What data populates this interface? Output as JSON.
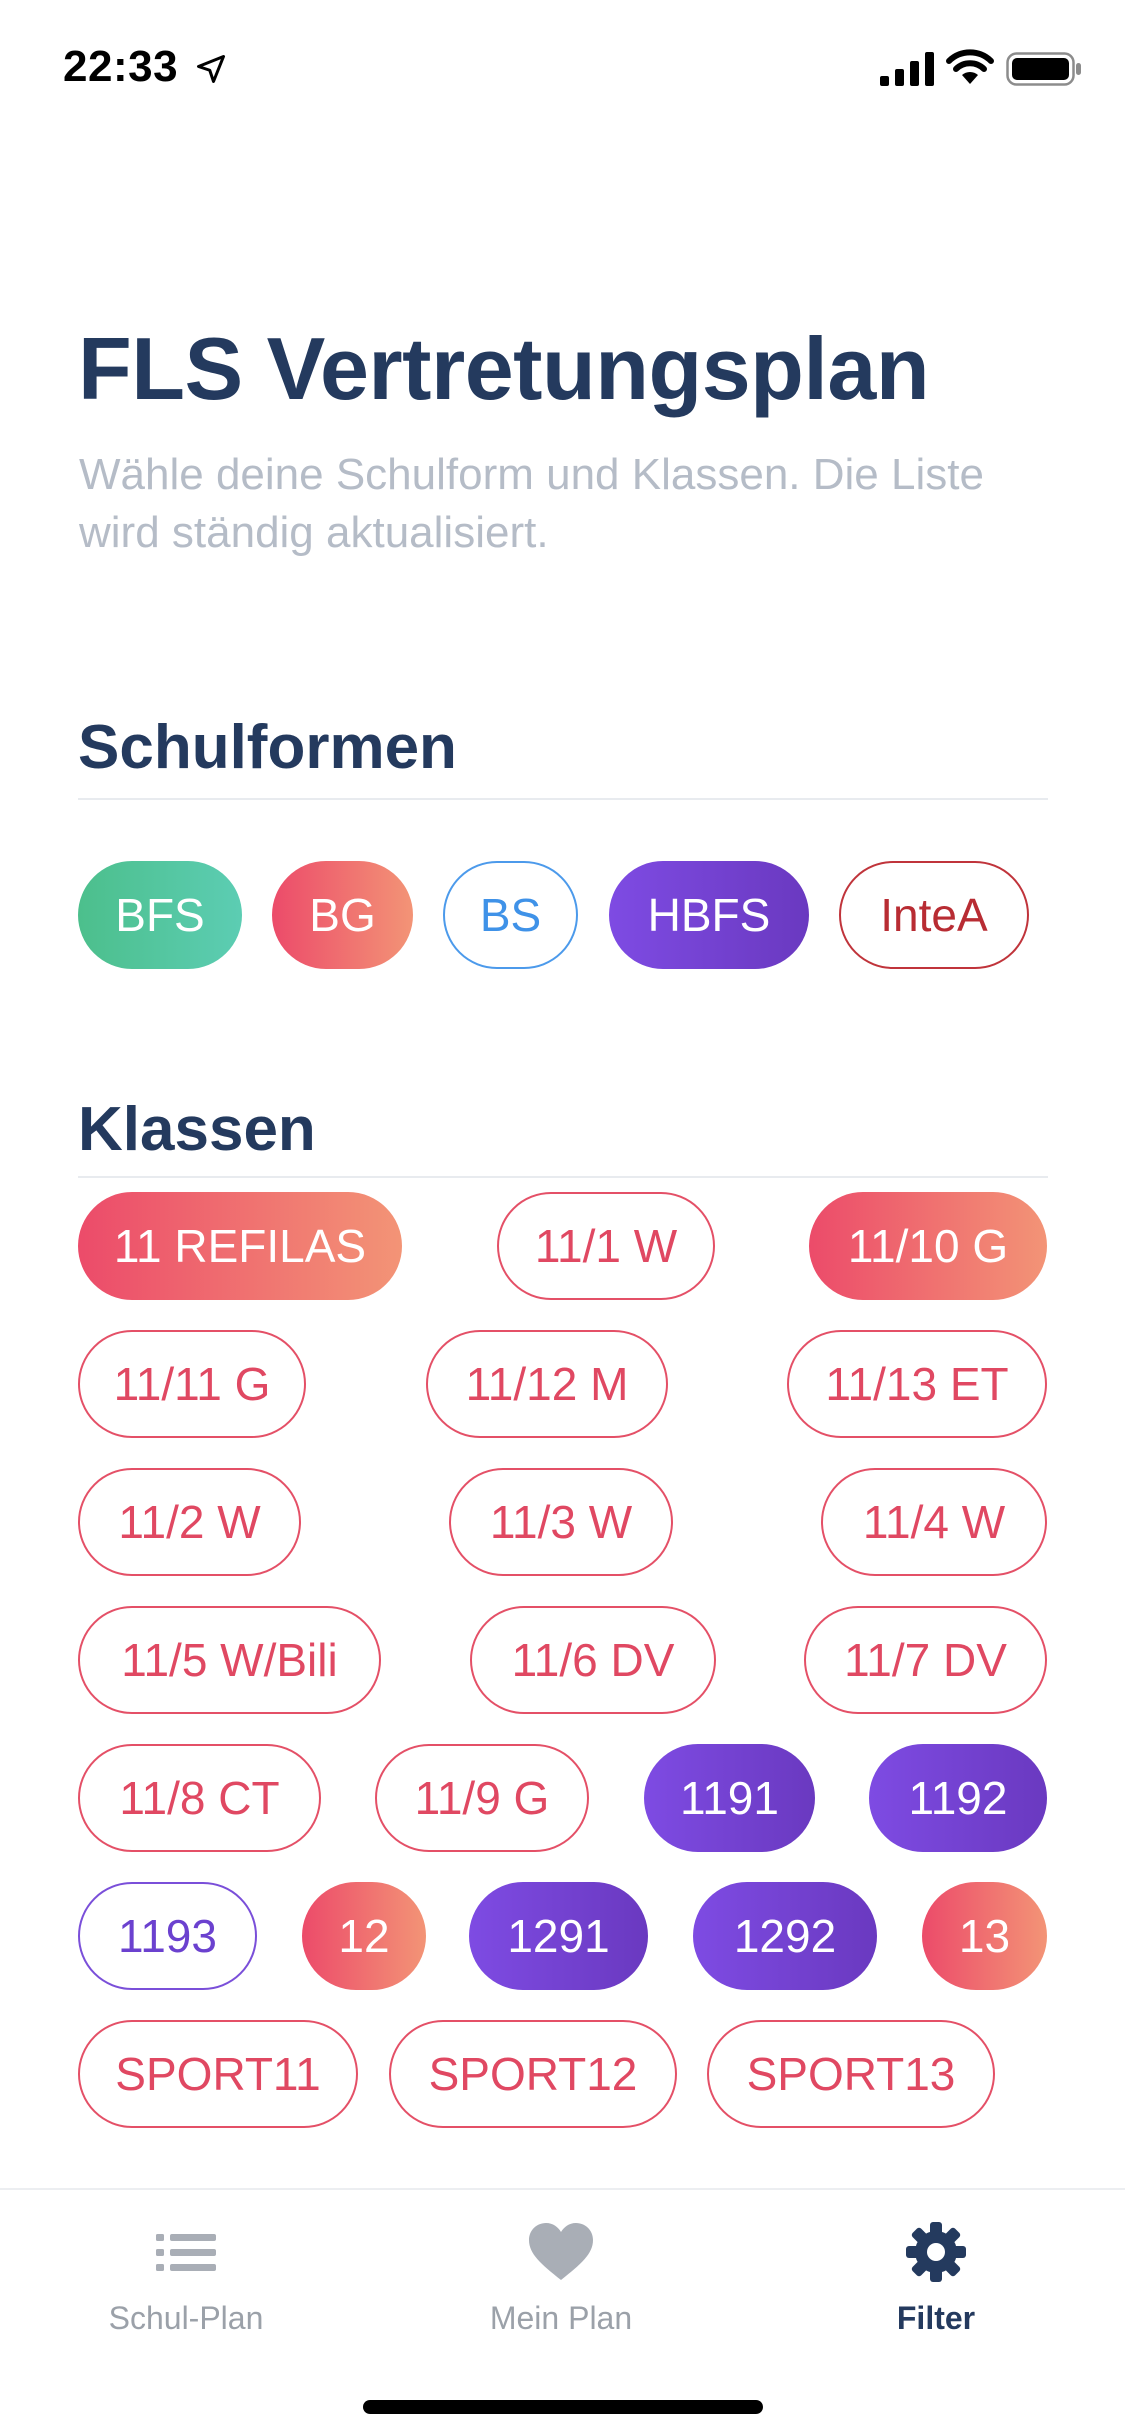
{
  "status_bar": {
    "time": "22:33",
    "icons": [
      "location-arrow-icon",
      "cellular-signal-icon",
      "wifi-icon",
      "battery-icon"
    ]
  },
  "header": {
    "title": "FLS Vertretungsplan",
    "subtitle": "Wähle deine Schulform und Klassen. Die Liste wird ständig aktualisiert."
  },
  "schulformen": {
    "title": "Schulformen",
    "items": [
      "BFS",
      "BG",
      "BS",
      "HBFS",
      "InteA"
    ]
  },
  "klassen": {
    "title": "Klassen",
    "items": [
      "11 REFILAS",
      "11/1 W",
      "11/10 G",
      "11/11 G",
      "11/12 M",
      "11/13 ET",
      "11/2 W",
      "11/3 W",
      "11/4 W",
      "11/5 W/Bili",
      "11/6 DV",
      "11/7 DV",
      "11/8 CT",
      "11/9 G",
      "1191",
      "1192",
      "1193",
      "12",
      "1291",
      "1292",
      "13",
      "SPORT11",
      "SPORT12",
      "SPORT13"
    ]
  },
  "tab_bar": {
    "tabs": [
      {
        "label": "Schul-Plan",
        "icon": "list-icon",
        "active": false
      },
      {
        "label": "Mein Plan",
        "icon": "heart-icon",
        "active": false
      },
      {
        "label": "Filter",
        "icon": "gear-icon",
        "active": true
      }
    ]
  },
  "colors": {
    "title": "#243a5e",
    "subtitle": "#b5bcc7",
    "green": "#4cbf8c",
    "coral": "#ec4b6a",
    "purple": "#7e4be3",
    "blue_outline": "#4c9aeb",
    "red_outline": "#e45067"
  }
}
